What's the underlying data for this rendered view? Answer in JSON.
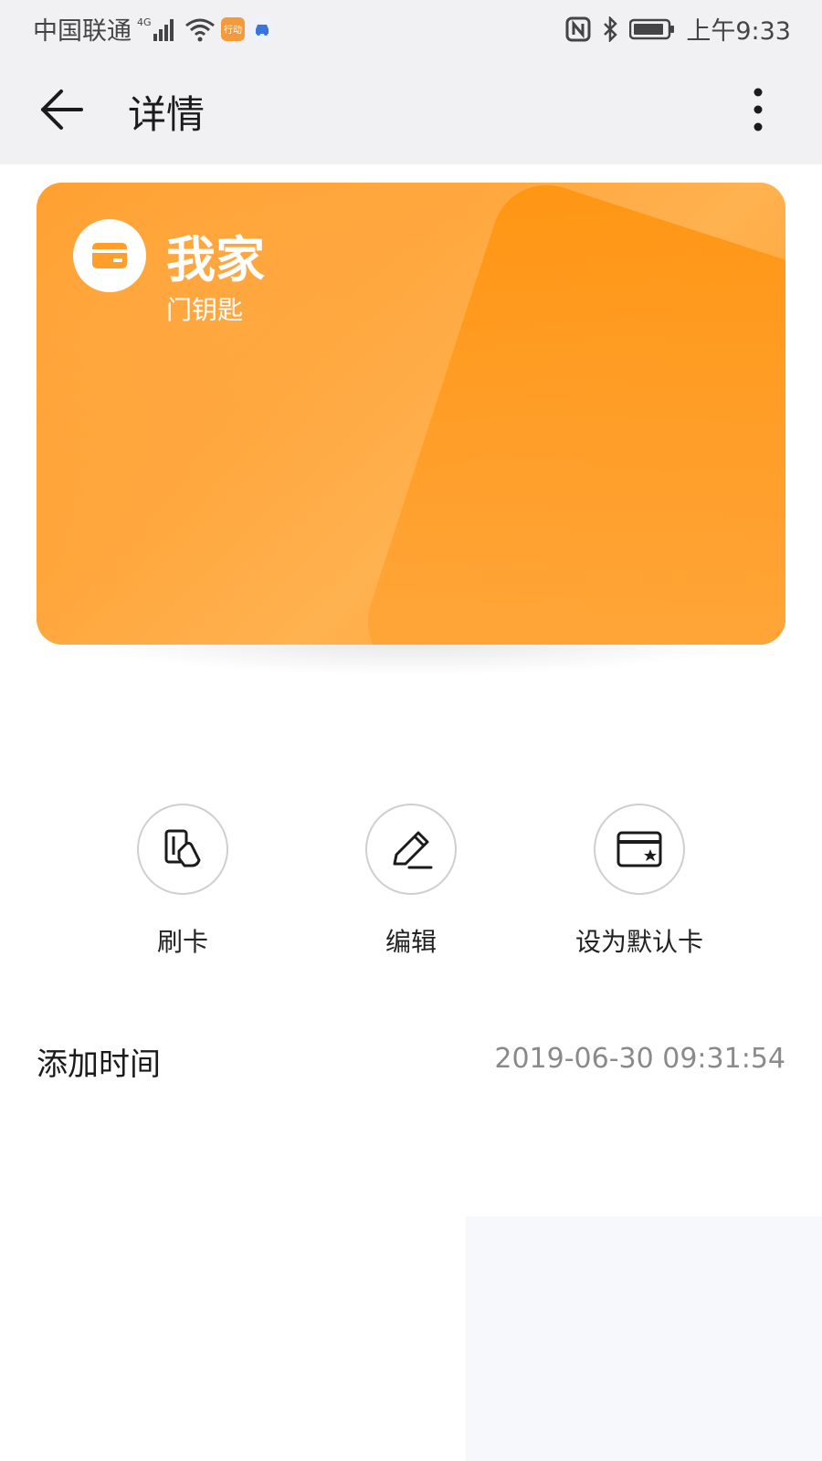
{
  "status_bar": {
    "carrier": "中国联通",
    "network": "4G",
    "app_badge_text": "行动",
    "time": "上午9:33"
  },
  "app_bar": {
    "title": "详情"
  },
  "card": {
    "title": "我家",
    "subtitle": "门钥匙",
    "colors": {
      "primary": "#ff9e2b",
      "deep": "#ff9410"
    }
  },
  "actions": [
    {
      "label": "刷卡",
      "icon": "card-tap-icon"
    },
    {
      "label": "编辑",
      "icon": "edit-pencil-icon"
    },
    {
      "label": "设为默认卡",
      "icon": "default-card-icon"
    }
  ],
  "details": {
    "added_time_label": "添加时间",
    "added_time_value": "2019-06-30 09:31:54"
  }
}
